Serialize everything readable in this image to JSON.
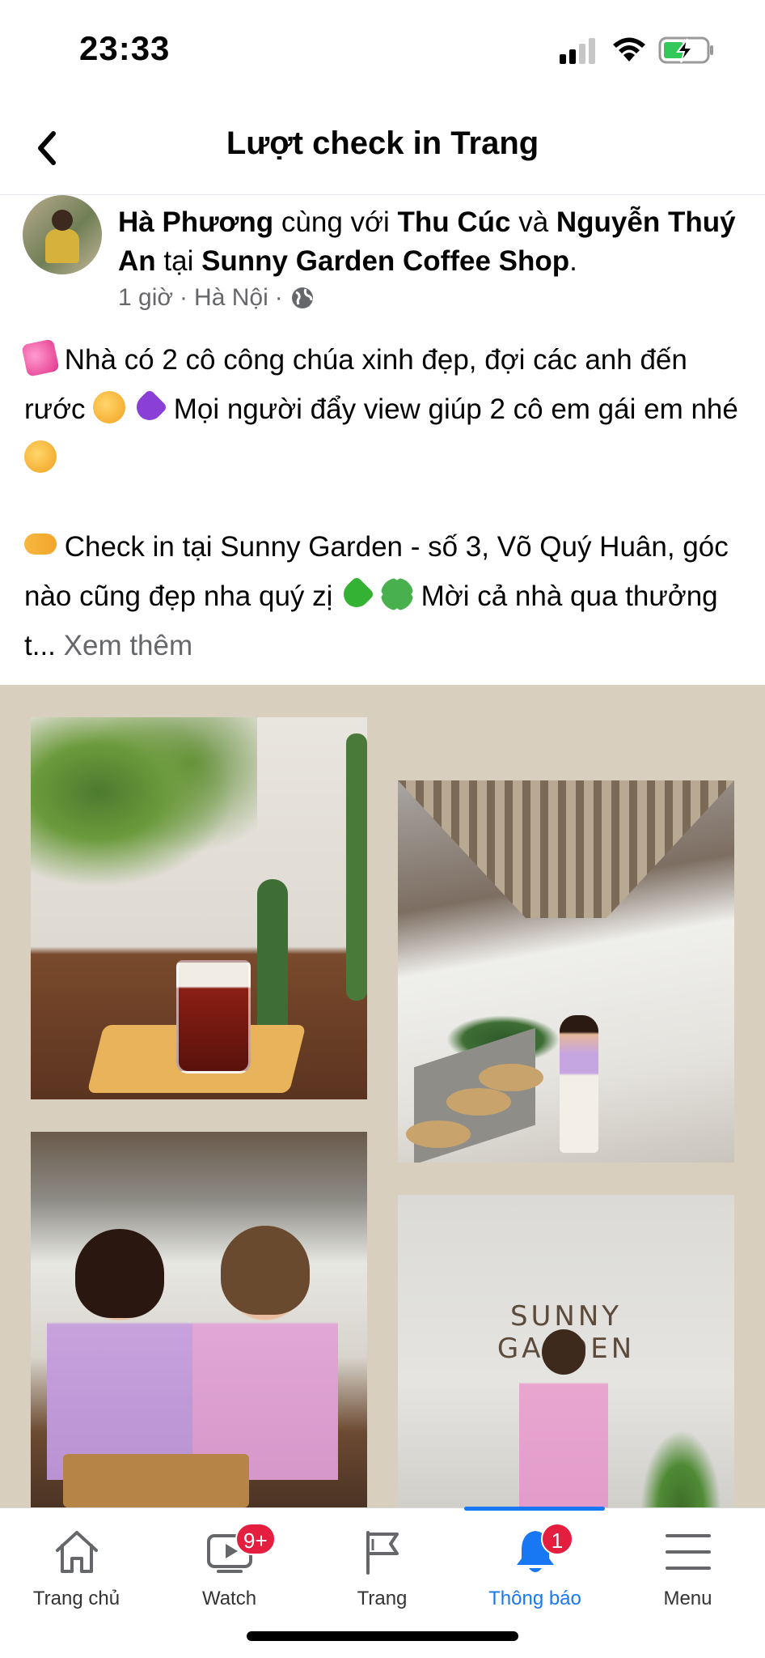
{
  "status_bar": {
    "time": "23:33",
    "icons": [
      "signal-icon",
      "wifi-icon",
      "battery-charging-icon"
    ]
  },
  "header": {
    "back_icon": "chevron-left-icon",
    "title": "Lượt check in Trang"
  },
  "post": {
    "author": "Hà Phương",
    "with_text": " cùng với ",
    "tagged_1": "Thu Cúc",
    "and_text": " và ",
    "tagged_2": "Nguyễn Thuý An",
    "at_text": " tại ",
    "place": "Sunny Garden Coffee Shop",
    "period": ".",
    "time": "1 giờ",
    "separator": "·",
    "location": "Hà Nội",
    "audience_icon": "globe-icon",
    "text_1a": " Nhà có 2 cô công chúa xinh đẹp, đợi các anh đến rước ",
    "text_1b": " Mọi người đẩy view giúp 2 cô em gái em nhé ",
    "text_2a": " Check in tại Sunny Garden - số 3, Võ Quý Huân, góc nào cũng đẹp nha quý zị ",
    "text_2b": " Mời cả nhà qua thưởng t...",
    "see_more": "Xem thêm",
    "photo_sign_line1": "SUNNY",
    "photo_sign_line2": "GARDEN"
  },
  "tab_bar": {
    "tabs": [
      {
        "label": "Trang chủ",
        "icon": "home-icon"
      },
      {
        "label": "Watch",
        "icon": "video-icon",
        "badge": "9+"
      },
      {
        "label": "Trang",
        "icon": "flag-icon"
      },
      {
        "label": "Thông báo",
        "icon": "bell-icon",
        "badge": "1",
        "active": true
      },
      {
        "label": "Menu",
        "icon": "menu-icon"
      }
    ]
  },
  "colors": {
    "accent": "#1877f2",
    "badge": "#e41e3f",
    "photo_background": "#d9cfbf"
  }
}
